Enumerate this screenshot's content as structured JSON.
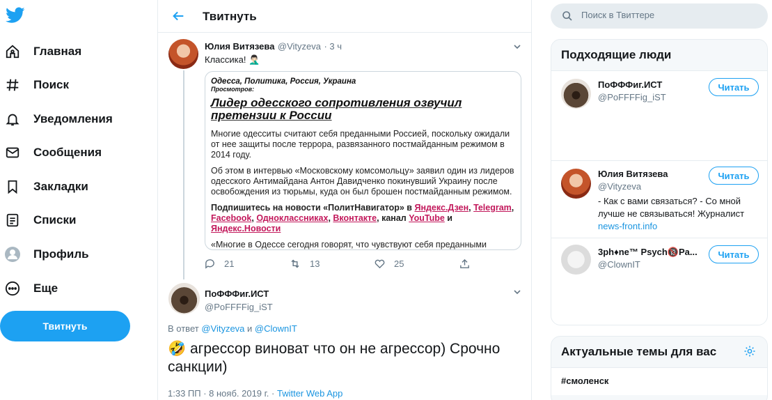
{
  "nav": {
    "items": [
      {
        "label": "Главная",
        "icon": "home-icon"
      },
      {
        "label": "Поиск",
        "icon": "hash-icon"
      },
      {
        "label": "Уведомления",
        "icon": "bell-icon"
      },
      {
        "label": "Сообщения",
        "icon": "mail-icon"
      },
      {
        "label": "Закладки",
        "icon": "bookmark-icon"
      },
      {
        "label": "Списки",
        "icon": "list-icon"
      },
      {
        "label": "Профиль",
        "icon": "profile-icon"
      },
      {
        "label": "Еще",
        "icon": "more-icon"
      }
    ],
    "tweet_button": "Твитнуть"
  },
  "header": {
    "title": "Твитнуть"
  },
  "tweet1": {
    "name": "Юлия Витязева",
    "handle": "@Vityzeva",
    "time": "· 3 ч",
    "text": "Классика! 🤦🏻‍♂️",
    "card": {
      "categories": "Одесса, Политика, Россия, Украина",
      "views": "Просмотров:",
      "headline": "Лидер одесского сопротивления озвучил претензии к России",
      "p1": "Многие одесситы считают себя преданными Россией, поскольку ожидали от нее защиты после террора, развязанного постмайданным режимом в 2014 году.",
      "p2": "Об этом в интервью «Московскому комсомольцу» заявил один из лидеров одесского Антимайдана Антон Давидченко покинувший Украину после освобождения из тюрьмы, куда он был брошен постмайданным режимом.",
      "p3_prefix": "Подпишитесь на новости «ПолитНавигатор» в ",
      "l_dzen": "Яндекс.Дзен",
      "l_telegram": "Telegram",
      "l_facebook": "Facebook",
      "l_ok": "Одноклассниках",
      "l_vk": "Вконтакте",
      "channel": ", канал ",
      "l_youtube": "YouTube",
      "and": " и ",
      "l_news": "Яндекс.Новости",
      "p4": "«Многие в Одессе сегодня говорят, что чувствуют себя преданными Россией. Они ждали реакции, ждали защиты. Ведь фактически убивали"
    },
    "replies": "21",
    "retweets": "13",
    "likes": "25"
  },
  "tweet2": {
    "name": "ПоФФФиг.ИСТ",
    "handle": "@PoFFFFig_iST",
    "reply_prefix": "В ответ ",
    "reply_user1": "@Vityzeva",
    "reply_and": " и ",
    "reply_user2": "@ClownIT",
    "text": "🤣 агрессор виноват что он не агрессор) Срочно санкции)",
    "timestamp": "1:33 ПП · 8 нояб. 2019 г. · ",
    "source": "Twitter Web App"
  },
  "search": {
    "placeholder": "Поиск в Твиттере"
  },
  "who_to_follow": {
    "title": "Подходящие люди",
    "people": [
      {
        "name": "ПоФФФиг.ИСТ",
        "handle": "@PoFFFFig_iST",
        "bio": "",
        "button": "Читать"
      },
      {
        "name": "Юлия Витязева",
        "handle": "@Vityzeva",
        "bio": "- Как с вами связаться? - Со мной лучше не связываться! Журналист",
        "link": "news-front.info",
        "button": "Читать"
      },
      {
        "name": "3ph♦ne™ Psych🔞Pa...",
        "handle": "@ClownIT",
        "bio": "",
        "button": "Читать"
      }
    ]
  },
  "trends": {
    "title": "Актуальные темы для вас",
    "items": [
      "#смоленск"
    ]
  },
  "colors": {
    "accent": "#1da1f2",
    "link": "#1b95e0",
    "muted": "#657786",
    "card_link": "#c2185b"
  }
}
